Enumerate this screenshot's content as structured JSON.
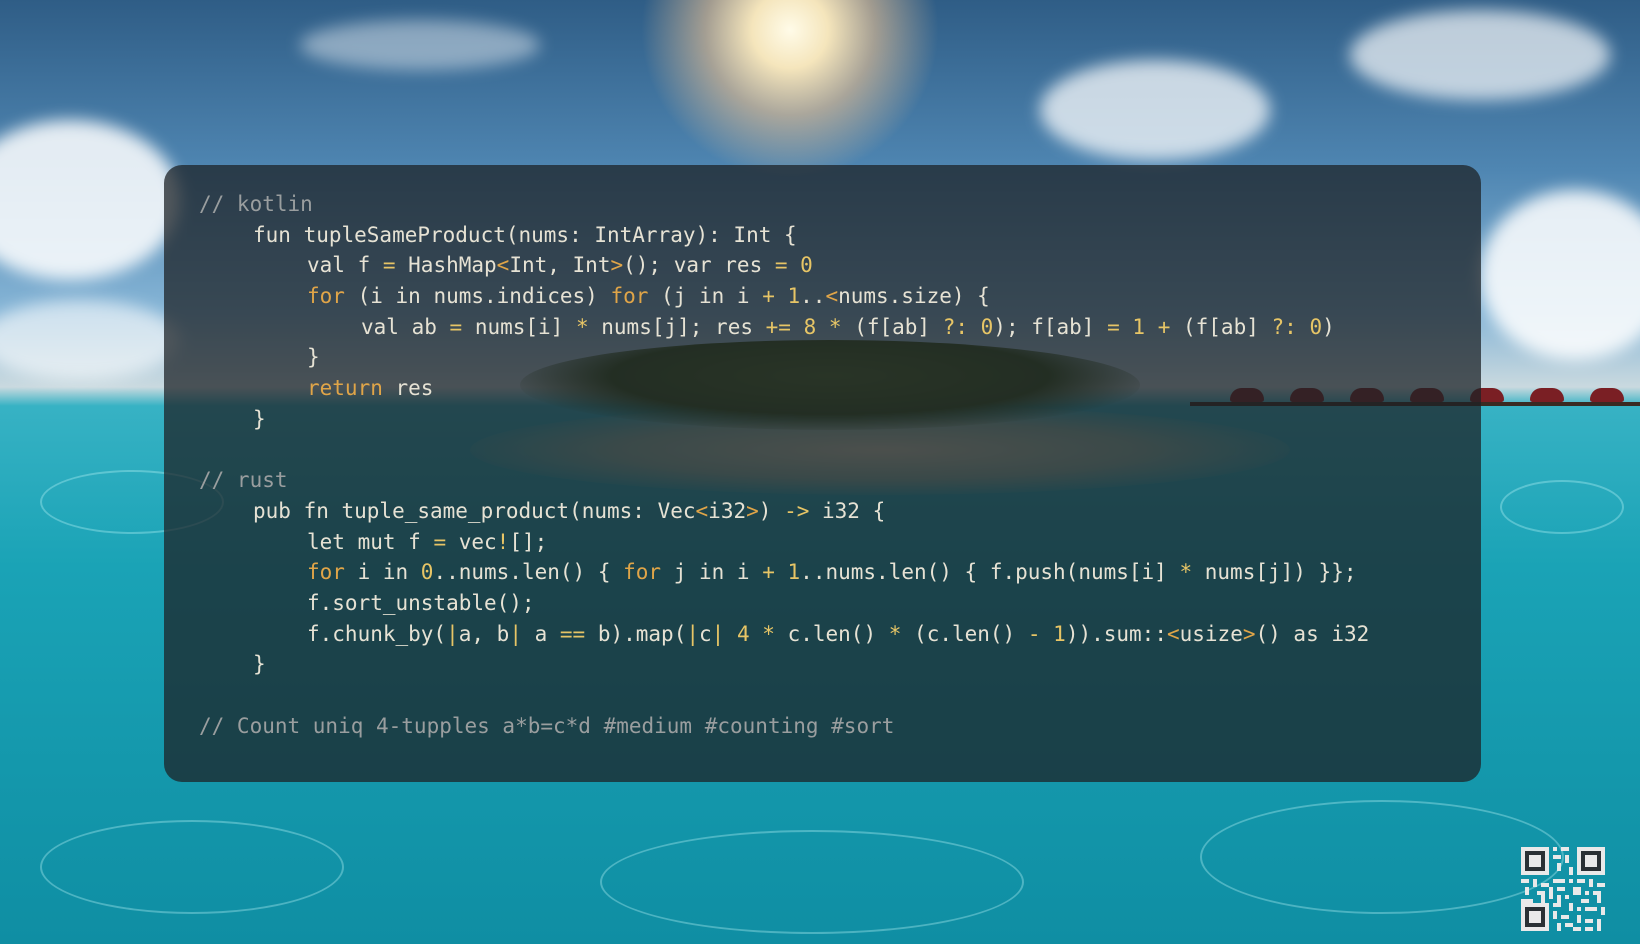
{
  "code": {
    "kotlin_comment": "// kotlin",
    "kotlin": [
      [
        "fun tupleSameProduct(nums: IntArray): Int {"
      ],
      [
        "val f ",
        "= ",
        "HashMap",
        "<",
        "Int, Int",
        ">",
        "(); var res ",
        "= ",
        "0"
      ],
      [
        "for",
        " (i in nums.indices) ",
        "for",
        " (j in i ",
        "+ ",
        "1",
        "..",
        "<",
        "nums.size) {"
      ],
      [
        "val ab ",
        "= ",
        "nums[i] ",
        "* ",
        "nums[j]; res ",
        "+= ",
        "8",
        " ",
        "* ",
        "(f[ab] ",
        "?: ",
        "0",
        "); f[ab] ",
        "= ",
        "1",
        " ",
        "+ ",
        "(f[ab] ",
        "?: ",
        "0",
        ")"
      ],
      [
        "}"
      ],
      [
        "return",
        " res"
      ],
      [
        "}"
      ]
    ],
    "rust_comment": "// rust",
    "rust": [
      [
        "pub fn tuple_same_product(nums: Vec",
        "<",
        "i32",
        ">",
        ") ",
        "->",
        " i32 {"
      ],
      [
        "let mut f ",
        "=",
        " vec",
        "!",
        "[];"
      ],
      [
        "for",
        " i in ",
        "0",
        "..nums.len() { ",
        "for",
        " j in i ",
        "+",
        " ",
        "1",
        "..nums.len() { f.push(nums[i] ",
        "*",
        " nums[j]) }};"
      ],
      [
        "f.sort_unstable();"
      ],
      [
        "f.chunk_by(",
        "|",
        "a, b",
        "|",
        " a ",
        "==",
        " b).map(",
        "|",
        "c",
        "|",
        " ",
        "4",
        " ",
        "*",
        " c.len() ",
        "*",
        " (c.len() ",
        "-",
        " ",
        "1",
        ")).sum::",
        "<",
        "usize",
        ">",
        "() as i32"
      ],
      [
        "}"
      ]
    ],
    "footer_comment": "// Count uniq 4-tupples a*b=c*d #medium #counting #sort"
  },
  "colors": {
    "panel": "rgba(28,34,38,0.74)",
    "text": "#e6e2d4",
    "comment": "#9a9e9f",
    "keyword": "#e0a548",
    "number": "#e7c566"
  }
}
